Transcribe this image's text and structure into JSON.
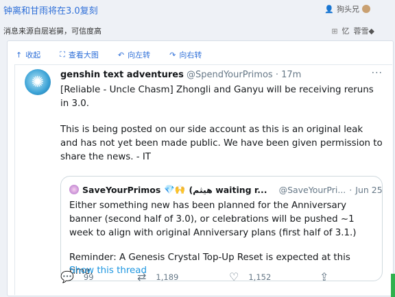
{
  "post": {
    "title": "钟离和甘雨将在3.0复刻",
    "author": "狗头兄",
    "subtitle": "消息来源自层岩舅，可信度高",
    "meta_items": [
      "忆",
      "蓉雪◆"
    ]
  },
  "toolbar": {
    "collapse": "收起",
    "view_large": "查看大图",
    "rotate_left": "向左转",
    "rotate_right": "向右转"
  },
  "tweet": {
    "name": "genshin text adventures",
    "handle": "@SpendYourPrimos",
    "dot": "·",
    "time": "17m",
    "more": "···",
    "paragraphs": [
      "[Reliable - Uncle Chasm] Zhongli and Ganyu will be receiving reruns in 3.0.",
      "This is being posted on our side account as this is an original leak and has not yet been made public. We have been given permission to share the news. - IT"
    ],
    "quote": {
      "name": "SaveYourPrimos",
      "emoji": "💎🙌",
      "name_rest": "(هيثم waiting r...",
      "handle": "@SaveYourPri...",
      "dot": "·",
      "date": "Jun 25",
      "paragraphs": [
        "Either something new has been planned for the Anniversary banner (second half of 3.0), or celebrations will be pushed ~1 week to align with original Anniversary plans (first half of 3.1.)",
        "Reminder: A Genesis Crystal Top-Up Reset is expected at this time."
      ],
      "link": "Show this thread"
    },
    "actions": {
      "replies": "99",
      "retweets": "1,189",
      "likes": "1,152"
    }
  },
  "icons": {
    "collapse": "up-arrow-icon",
    "view_large": "expand-icon",
    "rotate_left": "rotate-left-icon",
    "rotate_right": "rotate-right-icon",
    "reply": "reply-icon",
    "retweet": "retweet-icon",
    "like": "heart-icon",
    "share": "share-icon"
  },
  "colors": {
    "link_blue": "#2e6fd8",
    "twitter_blue": "#1b95e0",
    "muted": "#657786"
  }
}
